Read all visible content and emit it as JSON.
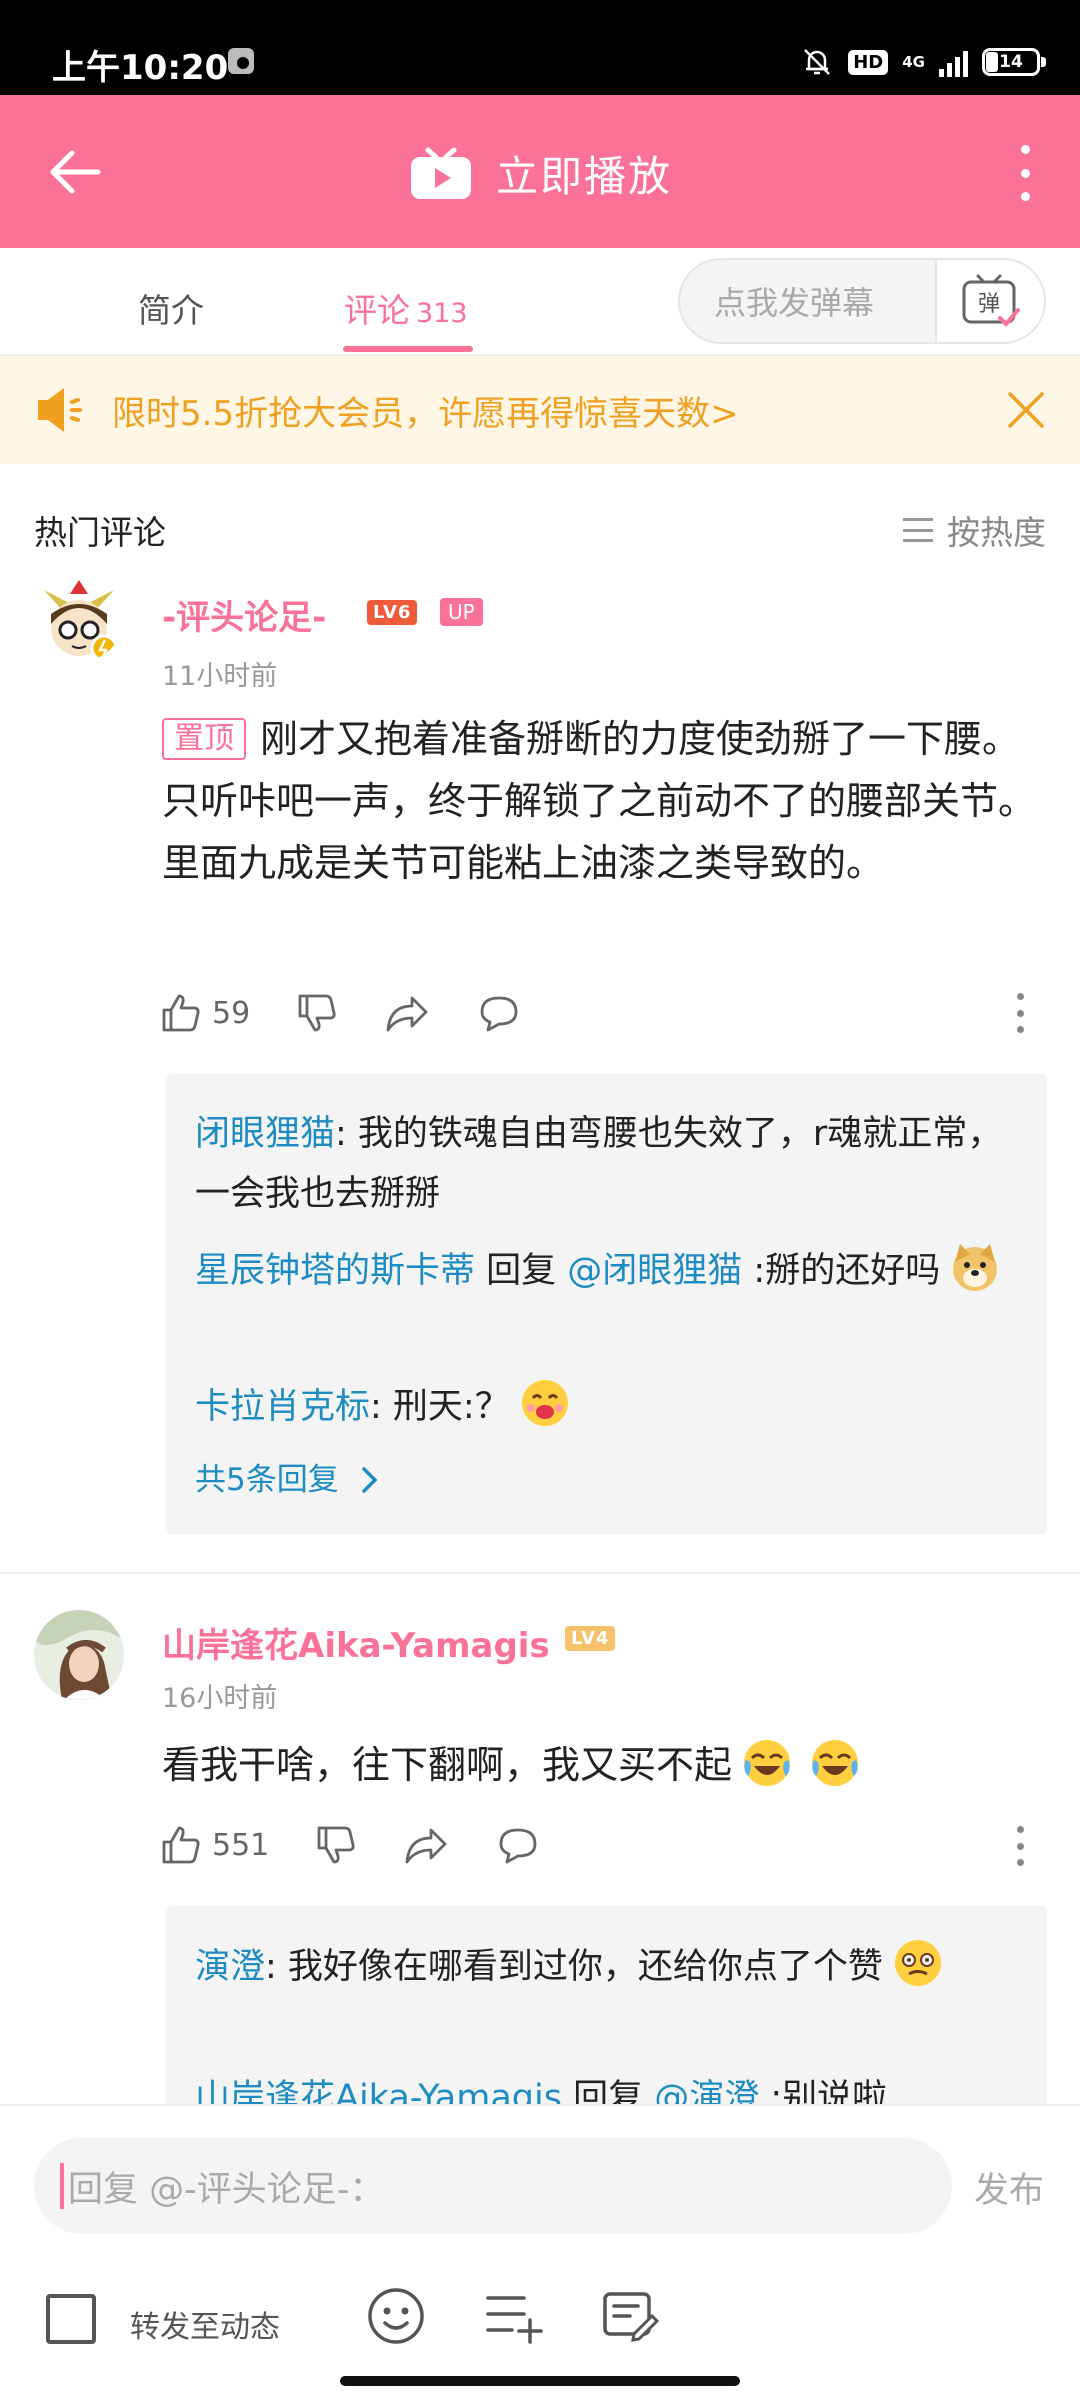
{
  "status_bar": {
    "time": "上午10:20",
    "network": "4G",
    "hd": "HD",
    "battery": "14"
  },
  "header": {
    "play_label": "立即播放"
  },
  "tabs": {
    "intro": "简介",
    "comments": "评论",
    "comments_count": "313"
  },
  "danmaku": {
    "placeholder": "点我发弹幕",
    "button_label": "弹"
  },
  "promo": {
    "text": "限时5.5折抢大会员，许愿再得惊喜天数>"
  },
  "comments_section": {
    "title": "热门评论",
    "sort_label": "按热度"
  },
  "comments": [
    {
      "username": "-评头论足-",
      "level": "LV6",
      "up_badge": "UP",
      "time": "11小时前",
      "pin_label": "置顶",
      "text": "刚才又抱着准备掰断的力度使劲掰了一下腰。只听咔吧一声，终于解锁了之前动不了的腰部关节。里面九成是关节可能粘上油漆之类导致的。",
      "likes": "59",
      "replies": [
        {
          "name": "闭眼狸猫",
          "text": ": 我的铁魂自由弯腰也失效了，r魂就正常，一会我也去掰掰"
        },
        {
          "name": "星辰钟塔的斯卡蒂",
          "reply_word": " 回复 ",
          "target": "@闭眼狸猫",
          "text": " :掰的还好吗"
        },
        {
          "name": "卡拉肖克标",
          "text": ": 刑天:？"
        }
      ],
      "total_replies": "共5条回复"
    },
    {
      "username": "山岸逢花Aika-Yamagis",
      "level": "LV4",
      "time": "16小时前",
      "text": "看我干啥，往下翻啊，我又买不起",
      "likes": "551",
      "replies": [
        {
          "name": "演澄",
          "text": ": 我好像在哪看到过你，还给你点了个赞"
        },
        {
          "name": "山岸逢花Aika-Yamagis",
          "reply_word": " 回复 ",
          "target": "@演澄",
          "text": " :别说啦"
        }
      ]
    }
  ],
  "bottom": {
    "input_placeholder": "回复 @-评头论足-：",
    "send_label": "发布",
    "forward_label": "转发至动态"
  },
  "colors": {
    "brand": "#fb7299",
    "link": "#1e8bc3",
    "promo": "#f0a020"
  }
}
